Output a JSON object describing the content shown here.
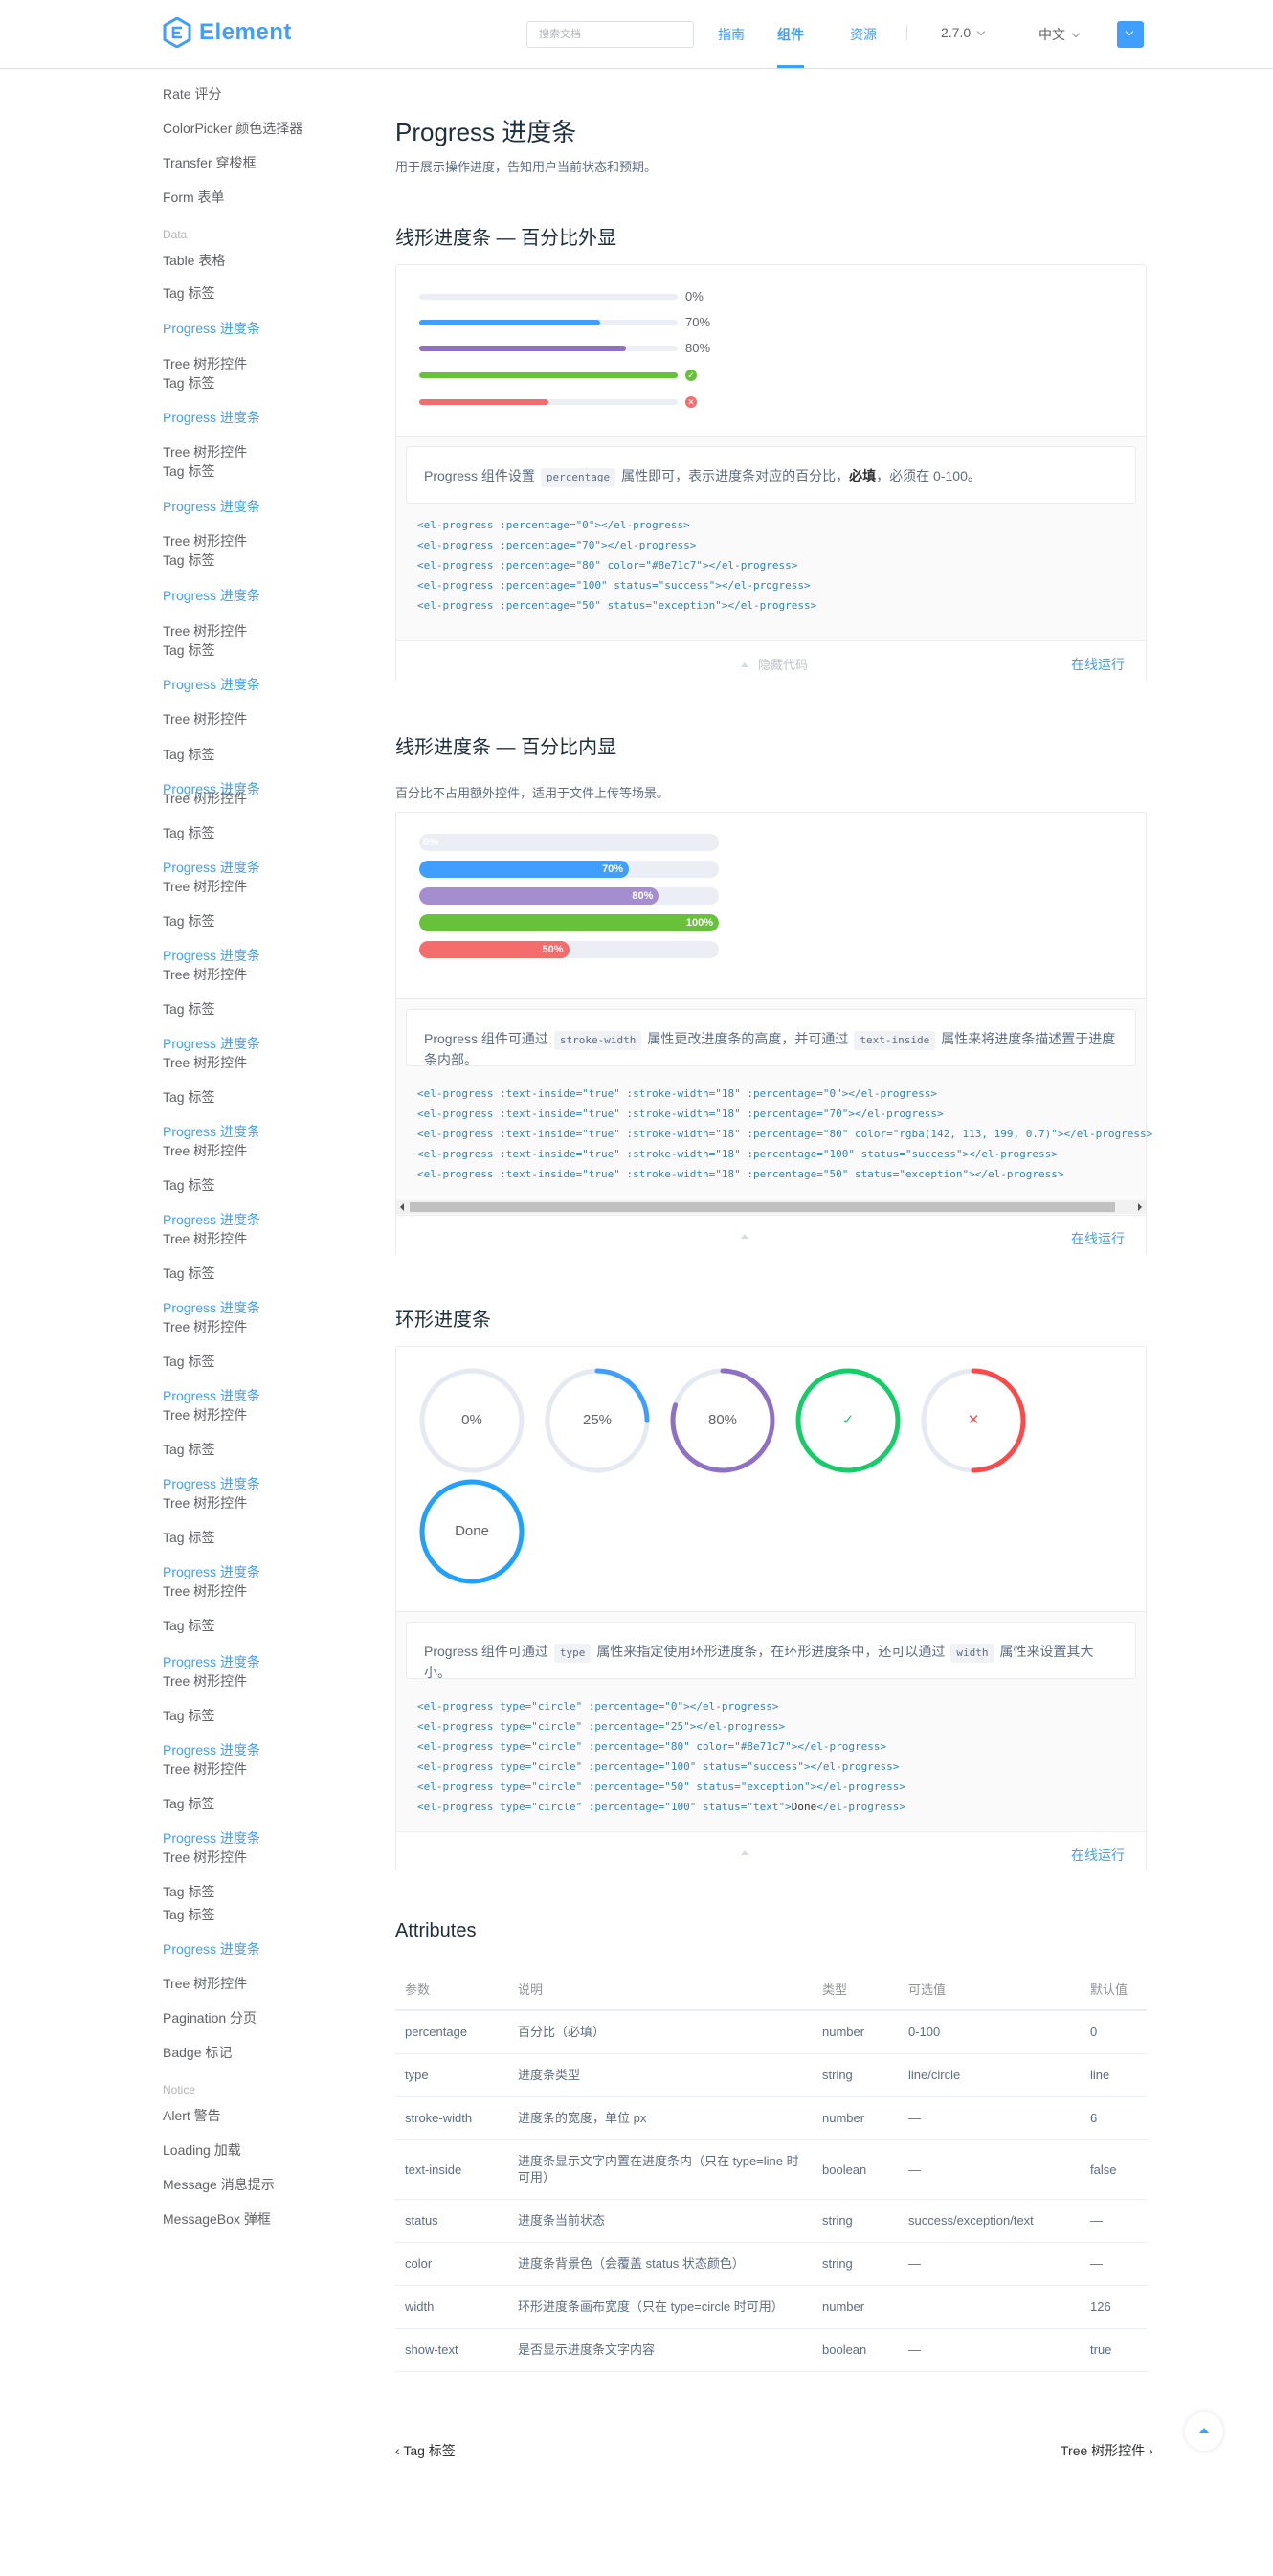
{
  "header": {
    "logo_text": "Element",
    "search_placeholder": "搜索文档",
    "nav": [
      "指南",
      "组件",
      "资源"
    ],
    "version": "2.7.0",
    "language": "中文",
    "accent": "#409eff"
  },
  "sidebar": {
    "items_top": [
      {
        "label": "Rate 评分",
        "active": false
      },
      {
        "label": "ColorPicker 颜色选择器",
        "active": false
      },
      {
        "label": "Transfer 穿梭框",
        "active": false
      },
      {
        "label": "Form 表单",
        "active": false
      }
    ],
    "group_data": "Data",
    "items_data": [
      "Table 表格",
      "Tag 标签",
      "Progress 进度条",
      "Tree 树形控件",
      "Tag 标签",
      "Progress 进度条",
      "Tree 树形控件",
      "Tag 标签",
      "Progress 进度条",
      "Tree 树形控件",
      "Tag 标签",
      "Progress 进度条",
      "Tree 树形控件",
      "Tag 标签",
      "Progress 进度条",
      "Tree 树形控件",
      "Tag 标签",
      "Progress 进度条",
      "Tree 树形控件",
      "Tag 标签",
      "Progress 进度条",
      "Tree 树形控件",
      "Tag 标签",
      "Progress 进度条",
      "Tree 树形控件",
      "Tag 标签",
      "Progress 进度条",
      "Tree 树形控件",
      "Tag 标签",
      "Progress 进度条",
      "Tree 树形控件",
      "Tag 标签",
      "Progress 进度条",
      "Tree 树形控件",
      "Tag 标签",
      "Progress 进度条",
      "Tree 树形控件",
      "Tag 标签",
      "Progress 进度条",
      "Tree 树形控件",
      "Tag 标签",
      "Progress 进度条",
      "Tree 树形控件",
      "Tag 标签",
      "Progress 进度条",
      "Tree 树形控件",
      "Tag 标签",
      "Progress 进度条",
      "Tree 树形控件",
      "Tag 标签",
      "Progress 进度条",
      "Tree 树形控件",
      "Tag 标签",
      "Progress 进度条",
      "Tree 树形控件",
      "Tag 标签",
      "Tag 标签",
      "Progress 进度条",
      "Tree 树形控件",
      "Pagination 分页",
      "Badge 标记"
    ],
    "group_notice": "Notice",
    "items_notice": [
      "Alert 警告",
      "Loading 加载",
      "Message 消息提示",
      "MessageBox 弹框"
    ]
  },
  "page": {
    "title": "Progress 进度条",
    "desc": "用于展示操作进度，告知用户当前状态和预期。"
  },
  "section1": {
    "title": "线形进度条 — 百分比外显",
    "bars": [
      {
        "percent": 0,
        "label": "0%",
        "color": "#409eff"
      },
      {
        "percent": 70,
        "label": "70%",
        "color": "#409eff"
      },
      {
        "percent": 80,
        "label": "80%",
        "color": "#8e71c7"
      },
      {
        "percent": 100,
        "label": "✓",
        "color": "#67c23a",
        "status": "success"
      },
      {
        "percent": 50,
        "label": "✕",
        "color": "#f56c6c",
        "status": "exception"
      }
    ],
    "desc_parts": [
      "Progress 组件设置",
      "percentage",
      "属性即可，表示进度条对应的百分比，",
      "必填",
      "，必须在 0-100。"
    ],
    "code": [
      "<el-progress :percentage=\"0\"></el-progress>",
      "<el-progress :percentage=\"70\"></el-progress>",
      "<el-progress :percentage=\"80\" color=\"#8e71c7\"></el-progress>",
      "<el-progress :percentage=\"100\" status=\"success\"></el-progress>",
      "<el-progress :percentage=\"50\" status=\"exception\"></el-progress>"
    ],
    "hide_label": "隐藏代码",
    "run_label": "在线运行"
  },
  "section2": {
    "title": "线形进度条 — 百分比内显",
    "desc": "百分比不占用额外控件，适用于文件上传等场景。",
    "bars": [
      {
        "percent": 0,
        "label": "0%",
        "color": "#409eff"
      },
      {
        "percent": 70,
        "label": "70%",
        "color": "#409eff"
      },
      {
        "percent": 80,
        "label": "80%",
        "color": "#a58ed0"
      },
      {
        "percent": 100,
        "label": "100%",
        "color": "#67c23a"
      },
      {
        "percent": 50,
        "label": "50%",
        "color": "#f56c6c"
      }
    ],
    "desc_parts": [
      "Progress 组件可通过",
      "stroke-width",
      "属性更改进度条的高度，并可通过",
      "text-inside",
      "属性来将进度条描述置于进度条内部。"
    ],
    "code": [
      "<el-progress :text-inside=\"true\" :stroke-width=\"18\" :percentage=\"0\"></el-progress>",
      "<el-progress :text-inside=\"true\" :stroke-width=\"18\" :percentage=\"70\"></el-progress>",
      "<el-progress :text-inside=\"true\" :stroke-width=\"18\" :percentage=\"80\" color=\"rgba(142, 113, 199, 0.7)\"></el-progress>",
      "<el-progress :text-inside=\"true\" :stroke-width=\"18\" :percentage=\"100\" status=\"success\"></el-progress>",
      "<el-progress :text-inside=\"true\" :stroke-width=\"18\" :percentage=\"50\" status=\"exception\"></el-progress>"
    ],
    "run_label": "在线运行"
  },
  "section3": {
    "title": "环形进度条",
    "circles": [
      {
        "percent": 0,
        "label": "0%",
        "color": "#409eff"
      },
      {
        "percent": 25,
        "label": "25%",
        "color": "#409eff"
      },
      {
        "percent": 80,
        "label": "80%",
        "color": "#8e71c7"
      },
      {
        "percent": 100,
        "label": "✓",
        "color": "#13ce66"
      },
      {
        "percent": 50,
        "label": "✕",
        "color": "#ff4949"
      },
      {
        "percent": 100,
        "label": "Done",
        "color": "#20a0ff"
      }
    ],
    "desc_parts": [
      "Progress 组件可通过",
      "type",
      "属性来指定使用环形进度条，在环形进度条中，还可以通过",
      "width",
      "属性来设置其大小。"
    ],
    "code": [
      "<el-progress type=\"circle\" :percentage=\"0\"></el-progress>",
      "<el-progress type=\"circle\" :percentage=\"25\"></el-progress>",
      "<el-progress type=\"circle\" :percentage=\"80\" color=\"#8e71c7\"></el-progress>",
      "<el-progress type=\"circle\" :percentage=\"100\" status=\"success\"></el-progress>",
      "<el-progress type=\"circle\" :percentage=\"50\" status=\"exception\"></el-progress>",
      "<el-progress type=\"circle\" :percentage=\"100\" status=\"text\">"
    ],
    "code_done_tail": "Done",
    "code_close_tail": "</el-progress>",
    "run_label": "在线运行"
  },
  "attributes": {
    "title": "Attributes",
    "headers": [
      "参数",
      "说明",
      "类型",
      "可选值",
      "默认值"
    ],
    "rows": [
      [
        "percentage",
        "百分比（必填）",
        "number",
        "0-100",
        "0"
      ],
      [
        "type",
        "进度条类型",
        "string",
        "line/circle",
        "line"
      ],
      [
        "stroke-width",
        "进度条的宽度，单位 px",
        "number",
        "—",
        "6"
      ],
      [
        "text-inside",
        "进度条显示文字内置在进度条内（只在 type=line 时可用）",
        "boolean",
        "—",
        "false"
      ],
      [
        "status",
        "进度条当前状态",
        "string",
        "success/exception/text",
        "—"
      ],
      [
        "color",
        "进度条背景色（会覆盖 status 状态颜色）",
        "string",
        "—",
        "—"
      ],
      [
        "width",
        "环形进度条画布宽度（只在 type=circle 时可用）",
        "number",
        "",
        "126"
      ],
      [
        "show-text",
        "是否显示进度条文字内容",
        "boolean",
        "—",
        "true"
      ]
    ]
  },
  "footer": {
    "prev": "Tag 标签",
    "next": "Tree 树形控件"
  }
}
